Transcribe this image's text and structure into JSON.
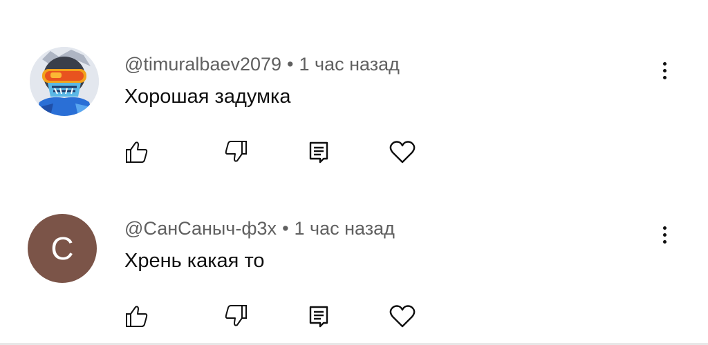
{
  "comments": [
    {
      "author": "@timuralbaev2079",
      "separator": "•",
      "time": "1 час назад",
      "text": "Хорошая задумка",
      "avatar": {
        "type": "image",
        "icon": "skier-avatar-icon"
      }
    },
    {
      "author": "@СанСаныч-ф3х",
      "separator": "•",
      "time": "1 час назад",
      "text": "Хрень какая то",
      "avatar": {
        "type": "letter",
        "letter": "С",
        "color": "#7b5448"
      }
    }
  ],
  "icons": {
    "like": "thumbs-up-icon",
    "dislike": "thumbs-down-icon",
    "reply": "reply-icon",
    "heart": "heart-icon",
    "menu": "more-vertical-icon"
  }
}
